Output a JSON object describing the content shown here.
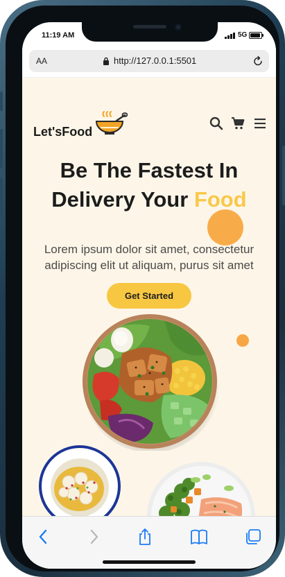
{
  "status_bar": {
    "time": "11:19 AM",
    "network": "5G"
  },
  "browser": {
    "text_size_label": "AA",
    "url": "http://127.0.0.1:5501"
  },
  "site": {
    "logo_text": "Let'sFood",
    "headline_line1": "Be The Fastest In",
    "headline_line2_prefix": "Delivery Your",
    "headline_accent": "Food",
    "description": "Lorem ipsum dolor sit amet, consectetur adipiscing elit ut aliquam, purus sit amet",
    "cta_label": "Get Started",
    "nav_icons": [
      "search-icon",
      "cart-icon",
      "menu-icon"
    ]
  },
  "colors": {
    "accent_yellow": "#f8c742",
    "accent_orange": "#f7a53b",
    "page_background": "#fdf6e8",
    "ios_blue": "#1a7cf5"
  },
  "toolbar_icons": [
    "back-icon",
    "forward-icon",
    "share-icon",
    "bookmarks-icon",
    "tabs-icon"
  ]
}
